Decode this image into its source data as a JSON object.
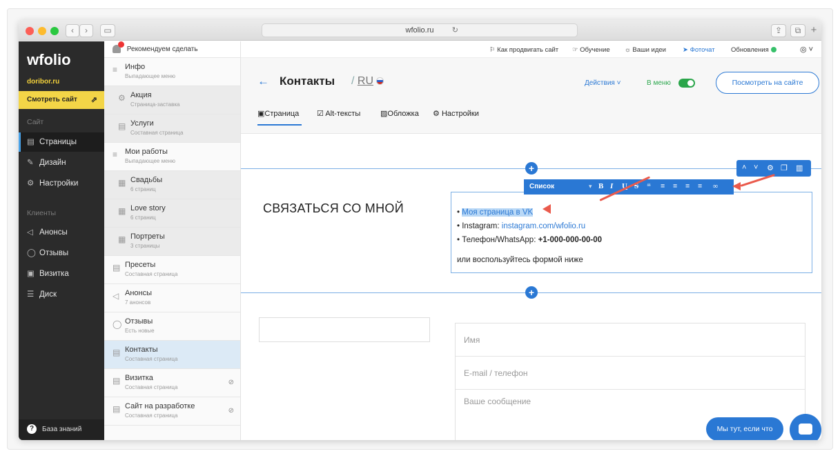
{
  "browser": {
    "url": "wfolio.ru",
    "nav_back": "‹",
    "nav_forward": "›",
    "reload": "↻",
    "share": "⇪",
    "tabs_btn": "⧉",
    "new_tab": "+",
    "colors": {
      "close": "#fc5f57",
      "min": "#fdbb2e",
      "max": "#2ac840"
    }
  },
  "sidebar": {
    "logo": "wfolio",
    "domain": "doribor.ru",
    "view_site": "Смотреть сайт",
    "section_site": "Сайт",
    "items_site": [
      {
        "label": "Страницы",
        "icon": "page-icon"
      },
      {
        "label": "Дизайн",
        "icon": "brush-icon"
      },
      {
        "label": "Настройки",
        "icon": "gear-icon"
      }
    ],
    "section_clients": "Клиенты",
    "items_clients": [
      {
        "label": "Анонсы",
        "icon": "megaphone-icon"
      },
      {
        "label": "Отзывы",
        "icon": "chat-icon"
      },
      {
        "label": "Визитка",
        "icon": "card-icon"
      },
      {
        "label": "Диск",
        "icon": "disk-icon"
      }
    ],
    "knowledge_base": "База знаний"
  },
  "pages_panel": {
    "recommend": "Рекомендуем сделать",
    "items": [
      {
        "title": "Инфо",
        "subtitle": "Выпадающее меню",
        "icon": "≡"
      },
      {
        "title": "Акция",
        "subtitle": "Страница-заставка",
        "icon": "⚙"
      },
      {
        "title": "Услуги",
        "subtitle": "Составная страница",
        "icon": "▤"
      },
      {
        "title": "Мои работы",
        "subtitle": "Выпадающее меню",
        "icon": "≡"
      },
      {
        "title": "Свадьбы",
        "subtitle": "6 страниц",
        "icon": "▦"
      },
      {
        "title": "Love story",
        "subtitle": "6 страниц",
        "icon": "▦"
      },
      {
        "title": "Портреты",
        "subtitle": "3 страницы",
        "icon": "▦"
      },
      {
        "title": "Пресеты",
        "subtitle": "Составная страница",
        "icon": "▤"
      },
      {
        "title": "Анонсы",
        "subtitle": "7 анонсов",
        "icon": "◁"
      },
      {
        "title": "Отзывы",
        "subtitle": "Есть новые",
        "icon": "◯"
      },
      {
        "title": "Контакты",
        "subtitle": "Составная страница",
        "icon": "▤"
      },
      {
        "title": "Визитка",
        "subtitle": "Составная страница",
        "icon": "▤"
      },
      {
        "title": "Сайт на разработке",
        "subtitle": "Составная страница",
        "icon": "▤"
      }
    ]
  },
  "topbar": {
    "promote": "Как продвигать сайт",
    "learning": "Обучение",
    "ideas": "Ваши идеи",
    "fotochat": "Фоточат",
    "updates": "Обновления"
  },
  "page": {
    "back_arrow": "←",
    "title": "Контакты",
    "lang": "RU",
    "actions": "Действия",
    "in_menu": "В меню",
    "view_on_site": "Посмотреть на сайте",
    "tabs": [
      "Страница",
      "Alt-тексты",
      "Обложка",
      "Настройки"
    ],
    "tab_icons": [
      "▣",
      "☑",
      "▨",
      "⚙"
    ]
  },
  "editor": {
    "heading": "СВЯЗАТЬСЯ СО МНОЙ",
    "bullet": "•",
    "line1": "Моя страница в VK",
    "line2_label": "Instagram: ",
    "line2_link": "instagram.com/wfolio.ru",
    "line3_label": "Телефон/WhatsApp: ",
    "line3_value": "+1-000-000-00-00",
    "line4": "или воспользуйтесь формой ниже",
    "toolbar_style": "Список",
    "toolbar_buttons": [
      "B",
      "I",
      "U",
      "S",
      "❝",
      "≡",
      "≡",
      "≡",
      "≡",
      "🔗"
    ]
  },
  "form": {
    "name": "Имя",
    "contact": "E-mail / телефон",
    "message": "Ваше сообщение"
  },
  "chat": {
    "label": "Мы тут, если что"
  }
}
